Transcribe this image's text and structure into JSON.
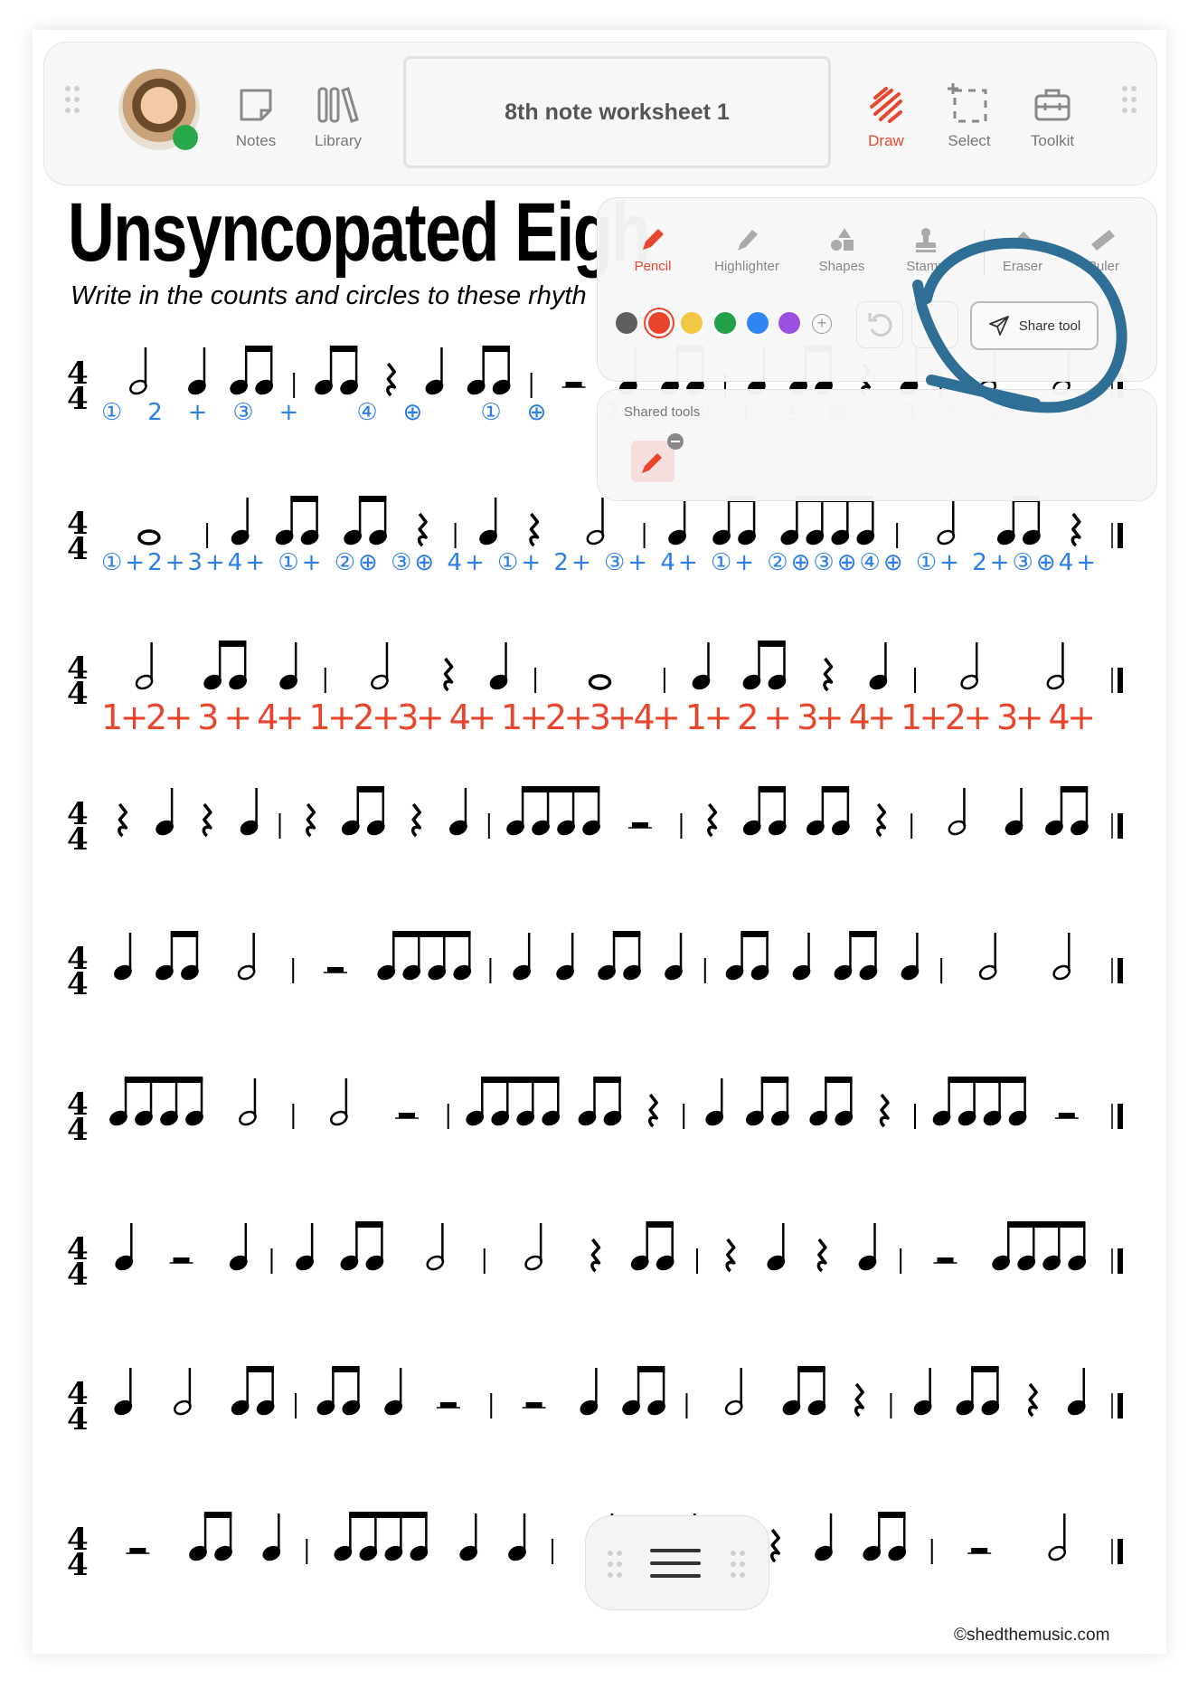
{
  "toolbar": {
    "notes_label": "Notes",
    "library_label": "Library",
    "document_title": "8th note worksheet 1",
    "draw_label": "Draw",
    "select_label": "Select",
    "toolkit_label": "Toolkit",
    "accent_color": "#e8452c",
    "status_color": "#27a94b"
  },
  "document": {
    "title": "Unsyncopated Eigh",
    "subtitle": "Write in the counts and circles to these rhyth",
    "time_signature": [
      "4",
      "4"
    ],
    "copyright": "©shedthemusic.com",
    "rows": [
      {
        "rhythm": [
          "h",
          "q",
          "e2",
          "bar",
          "e2",
          "qr",
          "q",
          "e2",
          "bar",
          "hr",
          "q",
          "e2",
          "bar",
          "q",
          "e2",
          "qr",
          "q",
          "bar",
          "h",
          "h"
        ],
        "counts": "①2+③+ ④⊕ ①⊕ 2+③+④⊕ 1+2+③",
        "counts_color": "#2b7de9"
      },
      {
        "rhythm": [
          "w",
          "bar",
          "q",
          "e2",
          "e2",
          "qr",
          "bar",
          "q",
          "qr",
          "h",
          "bar",
          "q",
          "e2",
          "e4",
          "bar",
          "h",
          "e2",
          "qr"
        ],
        "counts": "①+2+3+4+ ①+ ②⊕ ③⊕ 4+ ①+ 2+ ③+ 4+ ①+ ②⊕③⊕④⊕ ①+ 2+③⊕4+",
        "counts_color": "#2b7de9"
      },
      {
        "rhythm": [
          "h",
          "e2",
          "q",
          "bar",
          "h",
          "qr",
          "q",
          "bar",
          "w",
          "bar",
          "q",
          "e2",
          "qr",
          "q",
          "bar",
          "h",
          "h"
        ],
        "counts": "1+2+ 3 + 4+  1+2+3+ 4+  1+2+3+4+  1+ 2 + 3+ 4+  1+2+ 3+ 4+",
        "counts_color": "#e8452c"
      },
      {
        "rhythm": [
          "qr",
          "q",
          "qr",
          "q",
          "bar",
          "qr",
          "e2",
          "qr",
          "q",
          "bar",
          "e4",
          "hr",
          "bar",
          "qr",
          "e2",
          "e2",
          "qr",
          "bar",
          "h",
          "q",
          "e2"
        ]
      },
      {
        "rhythm": [
          "q",
          "e2",
          "h",
          "bar",
          "hr",
          "e4",
          "bar",
          "q",
          "q",
          "e2",
          "q",
          "bar",
          "e2",
          "q",
          "e2",
          "q",
          "bar",
          "h",
          "h"
        ]
      },
      {
        "rhythm": [
          "e4",
          "h",
          "bar",
          "h",
          "hr",
          "bar",
          "e4",
          "e2",
          "qr",
          "bar",
          "q",
          "e2",
          "e2",
          "qr",
          "bar",
          "e4",
          "hr"
        ]
      },
      {
        "rhythm": [
          "q",
          "hr",
          "q",
          "bar",
          "q",
          "e2",
          "h",
          "bar",
          "h",
          "qr",
          "e2",
          "bar",
          "qr",
          "q",
          "qr",
          "q",
          "bar",
          "hr",
          "e4"
        ]
      },
      {
        "rhythm": [
          "q",
          "h",
          "e2",
          "bar",
          "e2",
          "q",
          "hr",
          "bar",
          "hr",
          "q",
          "e2",
          "bar",
          "h",
          "e2",
          "qr",
          "bar",
          "q",
          "e2",
          "qr",
          "q"
        ]
      },
      {
        "rhythm": [
          "hr",
          "e2",
          "q",
          "bar",
          "e4",
          "q",
          "q",
          "bar",
          "h",
          "h",
          "bar",
          "qr",
          "q",
          "e2",
          "bar",
          "hr",
          "h"
        ]
      }
    ]
  },
  "draw_panel": {
    "tools": [
      {
        "label": "Pencil",
        "icon": "pencil-icon",
        "active": true
      },
      {
        "label": "Highlighter",
        "icon": "highlighter-icon"
      },
      {
        "label": "Shapes",
        "icon": "shapes-icon"
      },
      {
        "label": "Stamp",
        "icon": "stamp-icon"
      },
      {
        "label": "Eraser",
        "icon": "eraser-icon"
      },
      {
        "label": "Ruler",
        "icon": "ruler-icon"
      }
    ],
    "colors": [
      "#5f5f5f",
      "#e8452c",
      "#f2c744",
      "#23a04a",
      "#2f86f0",
      "#9b51e0"
    ],
    "selected_color": "#e8452c",
    "share_label": "Share tool",
    "annotation_color": "#2f6f96"
  },
  "shared_tools": {
    "label": "Shared tools"
  }
}
